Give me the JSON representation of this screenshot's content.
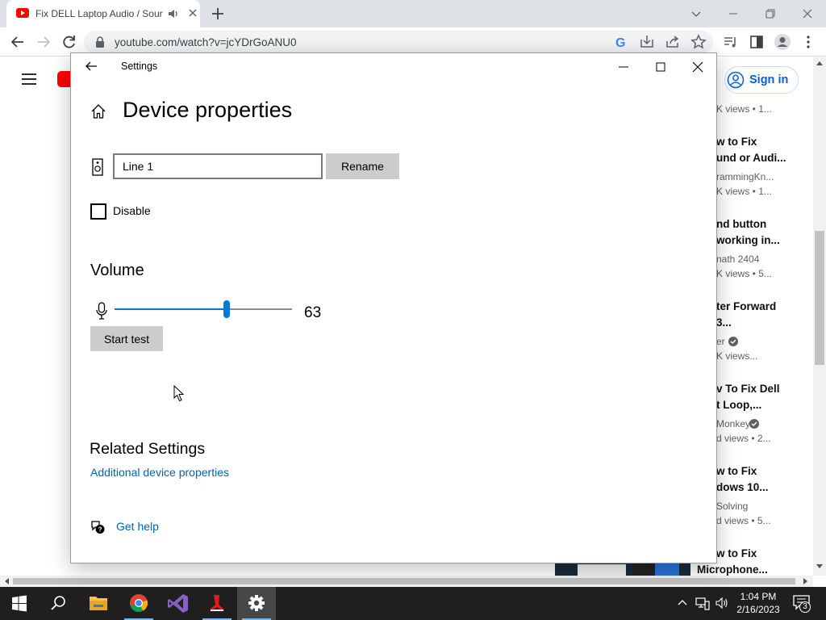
{
  "browser": {
    "tab_title": "Fix DELL Laptop Audio / Sound",
    "url": "youtube.com/watch?v=jcYDrGoANU0"
  },
  "youtube": {
    "signin_label": "Sign in",
    "related": [
      {
        "title1": "",
        "title2": "",
        "meta1": "",
        "meta2": "K views  •  1..."
      },
      {
        "title1": "w to Fix",
        "title2": "und or Audi...",
        "meta1": "rammingKn...",
        "meta2": "K views  •  1..."
      },
      {
        "title1": "nd button",
        "title2": "working in...",
        "meta1": "nath 2404",
        "meta2": "K views  •  5..."
      },
      {
        "title1": "ter Forward",
        "title2": "3...",
        "meta1": "er",
        "meta2": "K views..."
      },
      {
        "title1": "v To Fix Dell",
        "title2": "t Loop,...",
        "meta1": "Monkey",
        "meta2": "d views  •  2..."
      },
      {
        "title1": "w to Fix",
        "title2": "dows 10...",
        "meta1": "Solving",
        "meta2": "d views  •  5..."
      },
      {
        "title1": "w to Fix",
        "title2": "Microphone...",
        "meta1": "",
        "meta2": ""
      }
    ]
  },
  "settings": {
    "window_title": "Settings",
    "page_title": "Device properties",
    "device_name": "Line 1",
    "rename_label": "Rename",
    "disable_label": "Disable",
    "volume_heading": "Volume",
    "volume_value": "63",
    "volume_level": 63,
    "start_test_label": "Start test",
    "related_heading": "Related Settings",
    "additional_link": "Additional device properties",
    "help_link": "Get help"
  },
  "taskbar": {
    "time": "1:04 PM",
    "date": "2/16/2023",
    "notification_count": "3"
  },
  "colors": {
    "accent": "#0078d7",
    "link": "#0063b1",
    "youtube_red": "#ff0000",
    "taskbar": "#1f1f1f"
  }
}
